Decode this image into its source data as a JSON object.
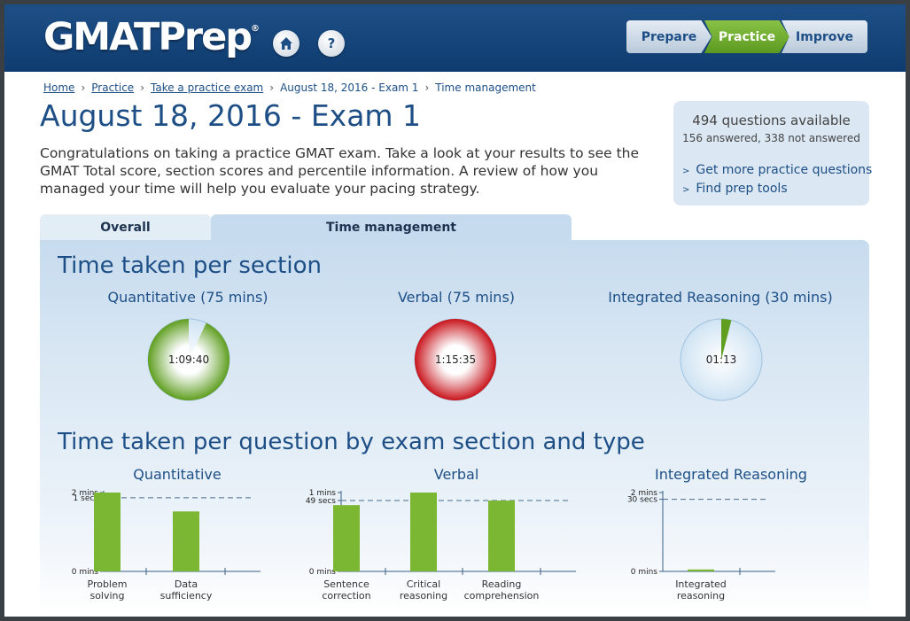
{
  "header": {
    "logo": "GMATPrep",
    "logo_mark": "®",
    "home_icon": "home-icon",
    "help_label": "?",
    "nav": {
      "prepare": "Prepare",
      "practice": "Practice",
      "improve": "Improve"
    },
    "colors": {
      "header": "#1d4f86",
      "active_nav": "#6aab2b"
    }
  },
  "breadcrumb": {
    "items": [
      "Home",
      "Practice",
      "Take a practice exam",
      "August 18, 2016 - Exam 1",
      "Time management"
    ],
    "separator": "›"
  },
  "page": {
    "title": "August 18, 2016 - Exam 1",
    "intro": "Congratulations on taking a practice GMAT exam. Take a look at your results to see the GMAT Total score, section scores and percentile information. A review of how you managed your time will help you evaluate your pacing strategy."
  },
  "sidebox": {
    "count": "494 questions available",
    "sub": "156 answered, 338 not answered",
    "link1": "Get more practice questions",
    "link2": "Find prep tools",
    "arrow": ">"
  },
  "tabs": {
    "overall": "Overall",
    "time_management": "Time management"
  },
  "section_time": {
    "title": "Time taken per section",
    "gauges": [
      {
        "label": "Quantitative (75 mins)",
        "value": "1:09:40",
        "fraction": 0.929,
        "style": "green"
      },
      {
        "label": "Verbal (75 mins)",
        "value": "1:15:35",
        "fraction": 1.0,
        "style": "red"
      },
      {
        "label": "Integrated Reasoning (30 mins)",
        "value": "01:13",
        "fraction": 0.04,
        "style": "blue"
      }
    ],
    "colors": {
      "green": "#5f9e1f",
      "red": "#c9141b",
      "blue": "#a9cde8"
    }
  },
  "chart_data": [
    {
      "type": "bar",
      "title": "Quantitative",
      "categories": [
        "Problem solving",
        "Data sufficiency"
      ],
      "values_secs": [
        121,
        92
      ],
      "ylim_secs": [
        0,
        121
      ],
      "ticks": [
        {
          "label": "2 mins",
          "secs": 121
        },
        {
          "label": "1 secs",
          "secs": 113
        },
        {
          "label": "0 mins",
          "secs": 0
        }
      ],
      "target_line_secs": 113
    },
    {
      "type": "bar",
      "title": "Verbal",
      "categories": [
        "Sentence correction",
        "Critical reasoning",
        "Reading comprehension"
      ],
      "values_secs": [
        58,
        69,
        62
      ],
      "ylim_secs": [
        0,
        69
      ],
      "ticks": [
        {
          "label": "1 mins",
          "secs": 69
        },
        {
          "label": "49 secs",
          "secs": 62
        },
        {
          "label": "0 mins",
          "secs": 0
        }
      ],
      "target_line_secs": 62
    },
    {
      "type": "bar",
      "title": "Integrated Reasoning",
      "categories": [
        "Integrated reasoning"
      ],
      "values_secs": [
        4
      ],
      "ylim_secs": [
        0,
        164
      ],
      "ticks": [
        {
          "label": "2 mins",
          "secs": 164
        },
        {
          "label": "30 secs",
          "secs": 150
        },
        {
          "label": "0 mins",
          "secs": 0
        }
      ],
      "target_line_secs": 150
    }
  ],
  "per_question_title": "Time taken per question by exam section and type",
  "bar_color": "#7cb734"
}
